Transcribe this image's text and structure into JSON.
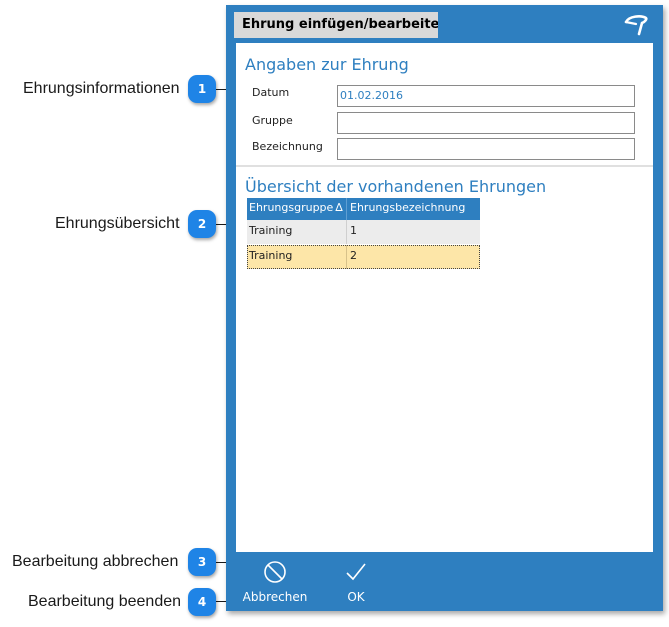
{
  "callouts": [
    {
      "number": "1",
      "label": "Ehrungsinformationen"
    },
    {
      "number": "2",
      "label": "Ehrungsübersicht"
    },
    {
      "number": "3",
      "label": "Bearbeitung abbrechen"
    },
    {
      "number": "4",
      "label": "Bearbeitung beenden"
    }
  ],
  "dialog": {
    "title": "Ehrung einfügen/bearbeite",
    "logo_icon": "app-logo-icon",
    "details": {
      "heading": "Angaben zur Ehrung",
      "fields": [
        {
          "label": "Datum",
          "value": "01.02.2016"
        },
        {
          "label": "Gruppe",
          "value": ""
        },
        {
          "label": "Bezeichnung",
          "value": ""
        }
      ]
    },
    "overview": {
      "heading": "Übersicht der vorhandenen Ehrungen",
      "columns": [
        "Ehrungsgruppe",
        "Ehrungsbezeichnung"
      ],
      "sort_indicator": "∆",
      "rows": [
        {
          "gruppe": "Training",
          "bezeichnung": "1",
          "selected": false
        },
        {
          "gruppe": "Training",
          "bezeichnung": "2",
          "selected": true
        }
      ]
    },
    "footer": {
      "cancel_label": "Abbrechen",
      "cancel_icon": "cancel-circle-icon",
      "ok_label": "OK",
      "ok_icon": "checkmark-icon"
    }
  },
  "colors": {
    "accent": "#2e7fc0",
    "badge": "#1f84e6",
    "row_alt": "#ececec",
    "row_selected": "#fde6a8"
  }
}
